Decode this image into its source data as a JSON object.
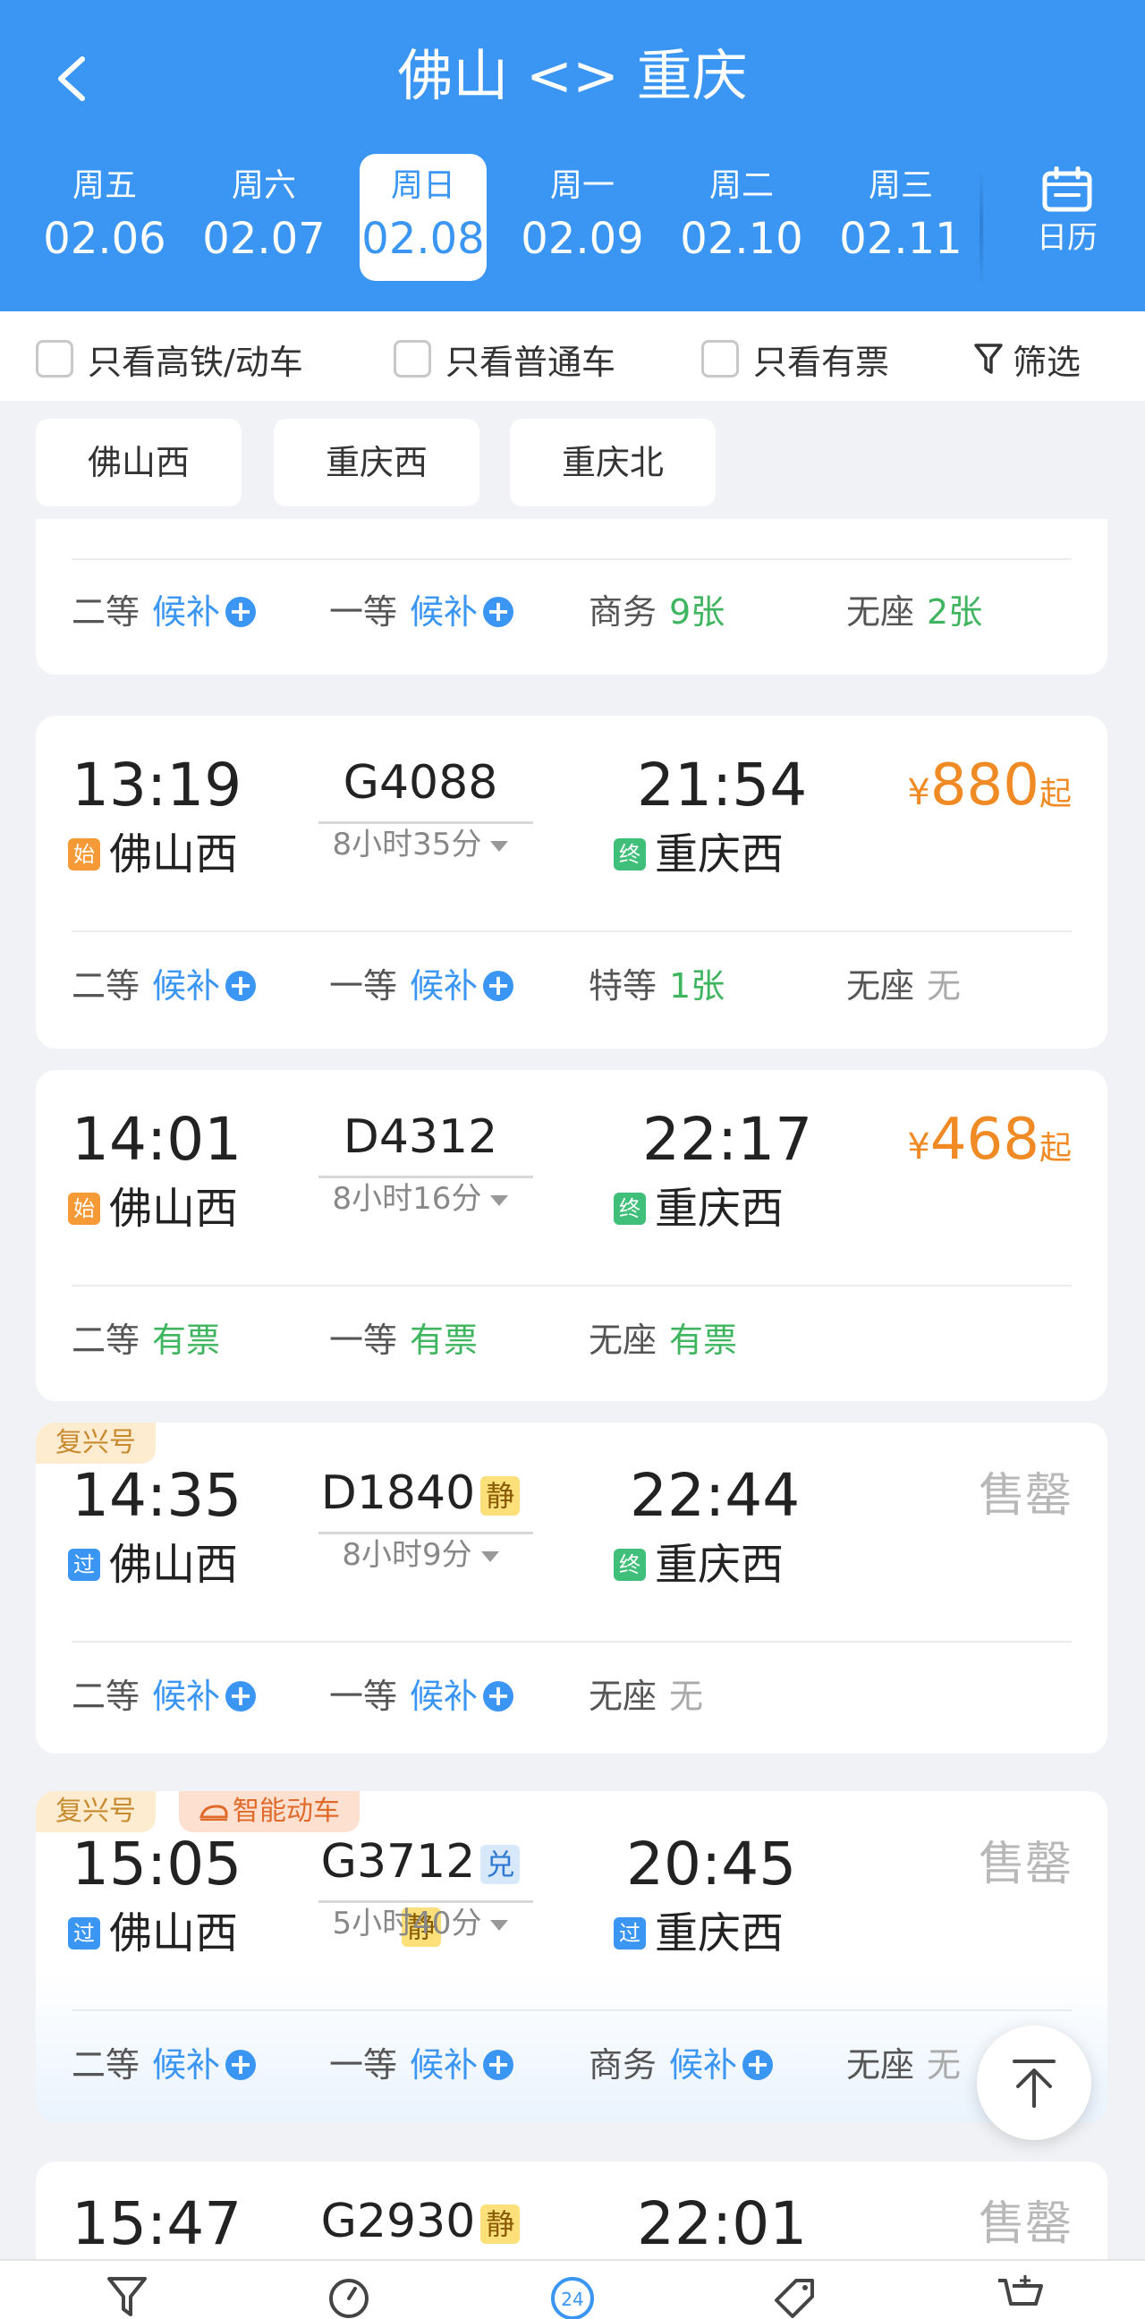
{
  "header": {
    "title": "佛山 <> 重庆",
    "calendar_label": "日历",
    "dates": [
      {
        "weekday": "周五",
        "date": "02.06"
      },
      {
        "weekday": "周六",
        "date": "02.07"
      },
      {
        "weekday": "周日",
        "date": "02.08",
        "selected": true
      },
      {
        "weekday": "周一",
        "date": "02.09"
      },
      {
        "weekday": "周二",
        "date": "02.10"
      },
      {
        "weekday": "周三",
        "date": "02.11"
      }
    ]
  },
  "filters": {
    "high_speed": "只看高铁/动车",
    "normal": "只看普通车",
    "available": "只看有票",
    "filter_label": "筛选"
  },
  "stations": [
    "佛山西",
    "重庆西",
    "重庆北"
  ],
  "trains": [
    {
      "partial": true,
      "seats": [
        {
          "name": "二等",
          "value": "候补",
          "type": "waitlist"
        },
        {
          "name": "一等",
          "value": "候补",
          "type": "waitlist"
        },
        {
          "name": "商务",
          "value": "9张",
          "type": "available"
        },
        {
          "name": "无座",
          "value": "2张",
          "type": "available"
        }
      ]
    },
    {
      "depart": "13:19",
      "number": "G4088",
      "arrive": "21:54",
      "duration": "8小时35分",
      "from_tag": "始",
      "from": "佛山西",
      "to_tag": "终",
      "to": "重庆西",
      "price_currency": "¥",
      "price": "880",
      "price_suffix": "起",
      "seats": [
        {
          "name": "二等",
          "value": "候补",
          "type": "waitlist"
        },
        {
          "name": "一等",
          "value": "候补",
          "type": "waitlist"
        },
        {
          "name": "特等",
          "value": "1张",
          "type": "available"
        },
        {
          "name": "无座",
          "value": "无",
          "type": "none"
        }
      ]
    },
    {
      "depart": "14:01",
      "number": "D4312",
      "arrive": "22:17",
      "duration": "8小时16分",
      "from_tag": "始",
      "from": "佛山西",
      "to_tag": "终",
      "to": "重庆西",
      "price_currency": "¥",
      "price": "468",
      "price_suffix": "起",
      "seats": [
        {
          "name": "二等",
          "value": "有票",
          "type": "available"
        },
        {
          "name": "一等",
          "value": "有票",
          "type": "available"
        },
        {
          "name": "无座",
          "value": "有票",
          "type": "available"
        }
      ]
    },
    {
      "ribbon": "复兴号",
      "depart": "14:35",
      "number": "D1840",
      "badge1": "静",
      "arrive": "22:44",
      "duration": "8小时9分",
      "from_tag": "过",
      "from": "佛山西",
      "to_tag": "终",
      "to": "重庆西",
      "status": "售罄",
      "seats": [
        {
          "name": "二等",
          "value": "候补",
          "type": "waitlist"
        },
        {
          "name": "一等",
          "value": "候补",
          "type": "waitlist"
        },
        {
          "name": "无座",
          "value": "无",
          "type": "none"
        }
      ]
    },
    {
      "ribbon": "复兴号",
      "ribbon2": "智能动车",
      "depart": "15:05",
      "number": "G3712",
      "badge1": "兑",
      "badge2": "静",
      "arrive": "20:45",
      "duration": "5小时40分",
      "from_tag": "过",
      "from": "佛山西",
      "to_tag": "过",
      "to": "重庆西",
      "status": "售罄",
      "seats": [
        {
          "name": "二等",
          "value": "候补",
          "type": "waitlist"
        },
        {
          "name": "一等",
          "value": "候补",
          "type": "waitlist"
        },
        {
          "name": "商务",
          "value": "候补",
          "type": "waitlist"
        },
        {
          "name": "无座",
          "value": "无",
          "type": "none"
        }
      ]
    },
    {
      "depart": "15:47",
      "number": "G2930",
      "badge1": "静",
      "arrive": "22:01",
      "status": "售罄"
    }
  ],
  "tabbar": {
    "icons": [
      "funnel-icon",
      "clock-icon",
      "24h-icon",
      "tag-icon",
      "cart-icon"
    ]
  },
  "colors": {
    "primary": "#3a96f2",
    "price": "#f08a24",
    "available": "#3fb55f",
    "soldout": "#b8b8b8"
  }
}
